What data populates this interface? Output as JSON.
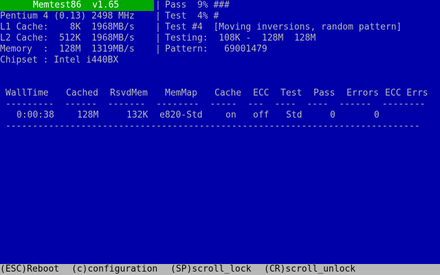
{
  "title": "Memtest86  v1.65",
  "left_info": {
    "cpu": "Pentium 4 (0.13) 2498 MHz",
    "l1": "L1 Cache:    8K  1968MB/s",
    "l2": "L2 Cache:  512K  1968MB/s",
    "memory": "Memory  :  128M  1319MB/s",
    "chipset": "Chipset : Intel i440BX"
  },
  "right_info": {
    "pass": "Pass  9% ###",
    "test": "Test  4% #",
    "test_num": "Test #4  [Moving inversions, random pattern]",
    "testing": "Testing:  108K -  128M  128M",
    "pattern": "Pattern:   69001479"
  },
  "table": {
    "headers": [
      "WallTime",
      "Cached",
      "RsvdMem",
      "MemMap",
      "Cache",
      "ECC",
      "Test",
      "Pass",
      "Errors",
      "ECC Errs"
    ],
    "row": [
      "0:00:38",
      "128M",
      "132K",
      "e820-Std",
      "on",
      "off",
      "Std",
      "0",
      "0",
      ""
    ]
  },
  "footer": {
    "reboot": "(ESC)Reboot",
    "config": "(c)configuration",
    "scroll_lock": "(SP)scroll_lock",
    "scroll_unlock": "(CR)scroll_unlock"
  },
  "colors": {
    "background": "#0000a8",
    "title_bar": "#00a800",
    "text": "#b8b8b8",
    "footer_bg": "#b8b8b8"
  }
}
